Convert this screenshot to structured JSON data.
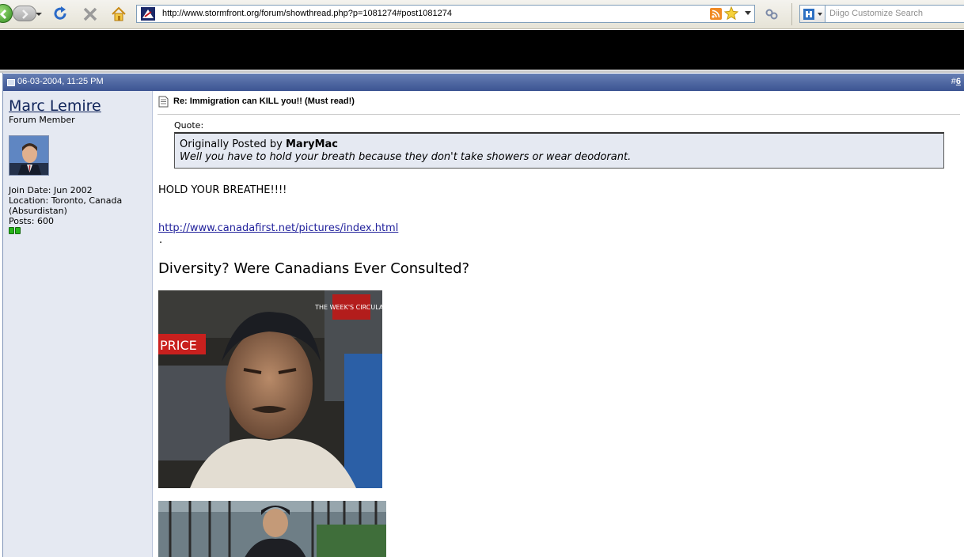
{
  "browser": {
    "address_url": "http://www.stormfront.org/forum/showthread.php?p=1081274#post1081274",
    "search_placeholder": "Diigo Customize Search"
  },
  "post": {
    "date": "06-03-2004, 11:25 PM",
    "number_prefix": "#",
    "number": "6",
    "title": "Re: Immigration can KILL you!! (Must read!)",
    "quote": {
      "label": "Quote:",
      "originally_posted_by": "Originally Posted by",
      "author": "MaryMac",
      "text": "Well you have to hold your breath because they don't take showers or wear deodorant."
    },
    "body_text": "HOLD YOUR BREATHE!!!!",
    "link": "http://www.canadafirst.net/pictures/index.html",
    "dot": ".",
    "heading": "Diversity? Were Canadians Ever Consulted?",
    "photo_sign_top": "THE WEEK'S CIRCULAR",
    "photo_sign_price": "PRICE"
  },
  "user": {
    "name": "Marc Lemire",
    "title": "Forum Member",
    "join_date": "Join Date: Jun 2002",
    "location": "Location: Toronto, Canada (Absurdistan)",
    "posts": "Posts: 600"
  },
  "colors": {
    "header_blue": "#3c5492",
    "user_panel": "#e5e9f2",
    "link": "#22229c"
  }
}
